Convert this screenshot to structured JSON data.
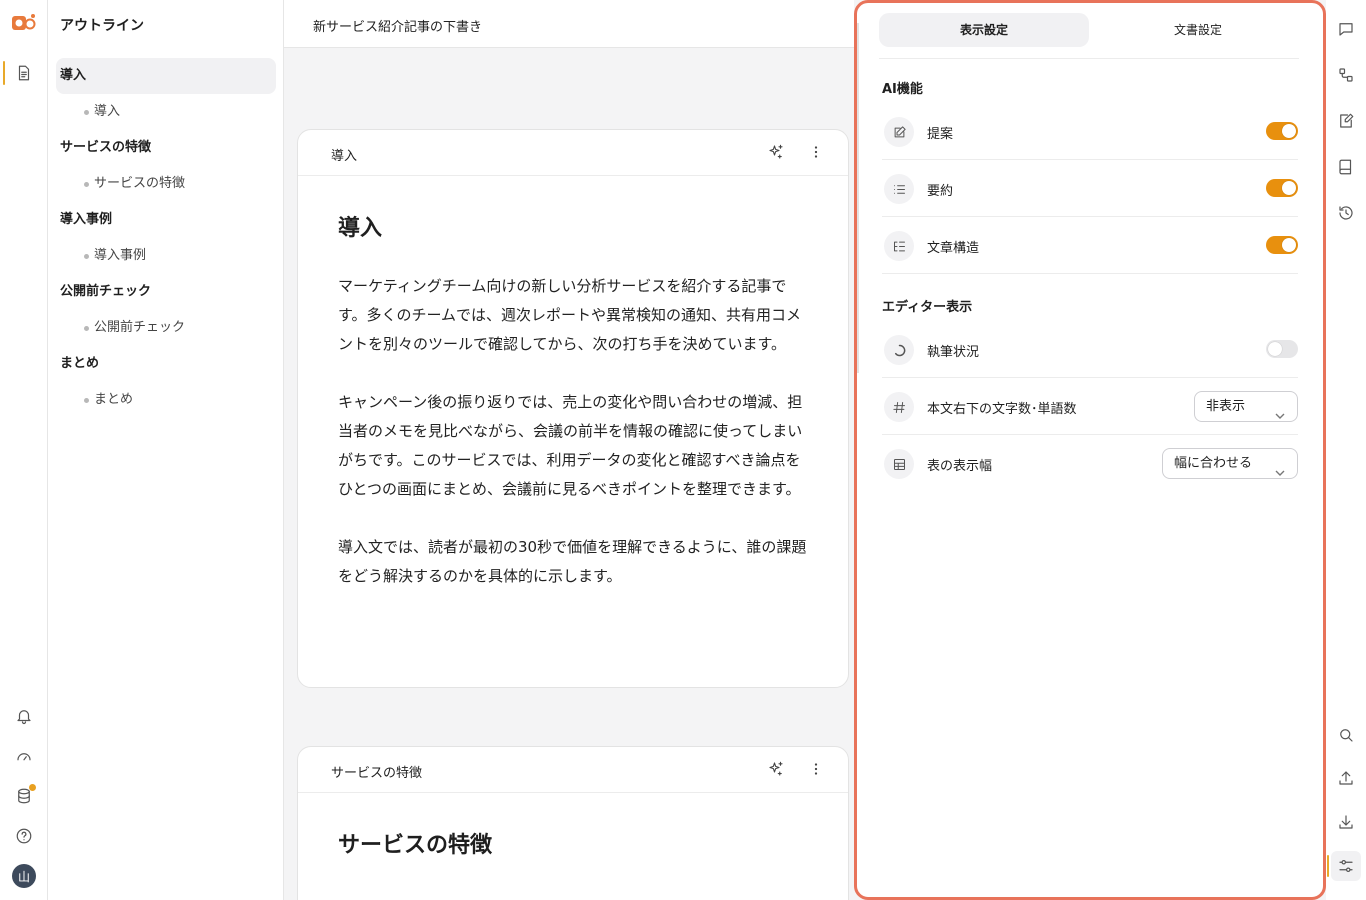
{
  "colors": {
    "accent": "#e8900e",
    "highlight_border": "#e8735a",
    "badge": "#e8a020"
  },
  "rail_left": {
    "top_icons": [
      "document-icon"
    ],
    "bottom_icons": [
      "bell-icon",
      "gauge-icon",
      "database-icon",
      "help-icon"
    ],
    "avatar_initial": "山"
  },
  "outline": {
    "title": "アウトライン",
    "sections": [
      {
        "label": "導入",
        "sub": "導入"
      },
      {
        "label": "サービスの特徴",
        "sub": "サービスの特徴"
      },
      {
        "label": "導入事例",
        "sub": "導入事例"
      },
      {
        "label": "公開前チェック",
        "sub": "公開前チェック"
      },
      {
        "label": "まとめ",
        "sub": "まとめ"
      }
    ]
  },
  "main": {
    "doc_title": "新サービス紹介記事の下書き",
    "cards": [
      {
        "label": "導入",
        "heading": "導入",
        "paragraphs": [
          "マーケティングチーム向けの新しい分析サービスを紹介する記事です。多くのチームでは、週次レポートや異常検知の通知、共有用コメントを別々のツールで確認してから、次の打ち手を決めています。",
          "キャンペーン後の振り返りでは、売上の変化や問い合わせの増減、担当者のメモを見比べながら、会議の前半を情報の確認に使ってしまいがちです。このサービスでは、利用データの変化と確認すべき論点をひとつの画面にまとめ、会議前に見るべきポイントを整理できます。",
          "導入文では、読者が最初の30秒で価値を理解できるように、誰の課題をどう解決するのかを具体的に示します。"
        ]
      },
      {
        "label": "サービスの特徴",
        "heading": "サービスの特徴",
        "paragraphs": []
      }
    ]
  },
  "settings": {
    "tabs": [
      "表示設定",
      "文書設定"
    ],
    "ai_section_title": "AI機能",
    "ai_items": [
      {
        "label": "提案",
        "icon": "edit-icon",
        "enabled": true
      },
      {
        "label": "要約",
        "icon": "list-icon",
        "enabled": true
      },
      {
        "label": "文章構造",
        "icon": "structure-icon",
        "enabled": true
      }
    ],
    "editor_section_title": "エディター表示",
    "writing_status": {
      "label": "執筆状況",
      "icon": "progress-icon",
      "enabled": false
    },
    "char_count": {
      "label": "本文右下の文字数･単語数",
      "icon": "hash-icon",
      "value": "非表示"
    },
    "table_width": {
      "label": "表の表示幅",
      "icon": "table-icon",
      "value": "幅に合わせる"
    }
  },
  "rail_right": {
    "top_icons": [
      "comment-icon",
      "workflow-icon",
      "note-edit-icon",
      "book-icon",
      "history-icon"
    ],
    "bottom_icons": [
      "search-icon",
      "upload-icon",
      "download-icon",
      "settings-sliders-icon"
    ]
  }
}
